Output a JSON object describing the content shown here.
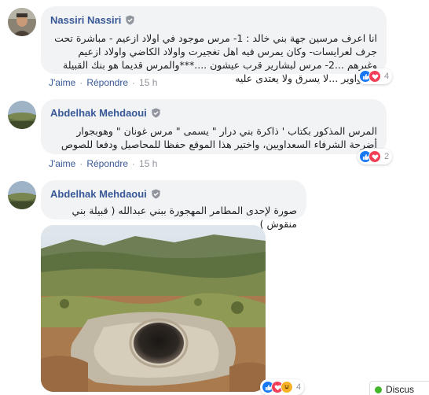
{
  "comments": [
    {
      "author": "Nassiri Nassiri",
      "text": "انا اعرف مرسين جهة بني خالد : 1- مرس موجود في اولاد ازعيم - مباشرة تحت جرف لعرايسات- وكان يمرس فيه اهل تغجيرت واولاد الكاضي واولاد ازعيم وغيرهم ...2- مرس لبشارير قرب عيشون ....***والمرس قديما هو بنك القبيلة والدواوير ...لا يسرق ولا يعتدى عليه",
      "like_label": "J'aime",
      "reply_label": "Répondre",
      "time": "15 h",
      "reaction_count": "4"
    },
    {
      "author": "Abdelhak Mehdaoui",
      "text": "المرس المذكور بكتاب ' ذاكرة بني درار \" يسمى \" مرس غونان \" وهوبجوار أضرحة الشرفاء السعداويين، واختير هذا الموقع حفظا للمحاصيل ودفعا للصوص",
      "like_label": "J'aime",
      "reply_label": "Répondre",
      "time": "15 h",
      "reaction_count": "2"
    },
    {
      "author": "Abdelhak Mehdaoui",
      "text": "صورة لإحدى المطامر المهجورة ببني عبدالله ( قبيلة بني منقوش )",
      "reaction_count": "4"
    }
  ],
  "chat": {
    "label": "Discus"
  },
  "colors": {
    "name": "#385898",
    "bubble": "#f2f3f5",
    "like": "#1877f2",
    "love": "#f33e58",
    "haha": "#f7b125",
    "online": "#42b72a"
  },
  "icons": [
    "verified-badge-icon",
    "like-reaction-icon",
    "love-reaction-icon",
    "haha-reaction-icon"
  ]
}
